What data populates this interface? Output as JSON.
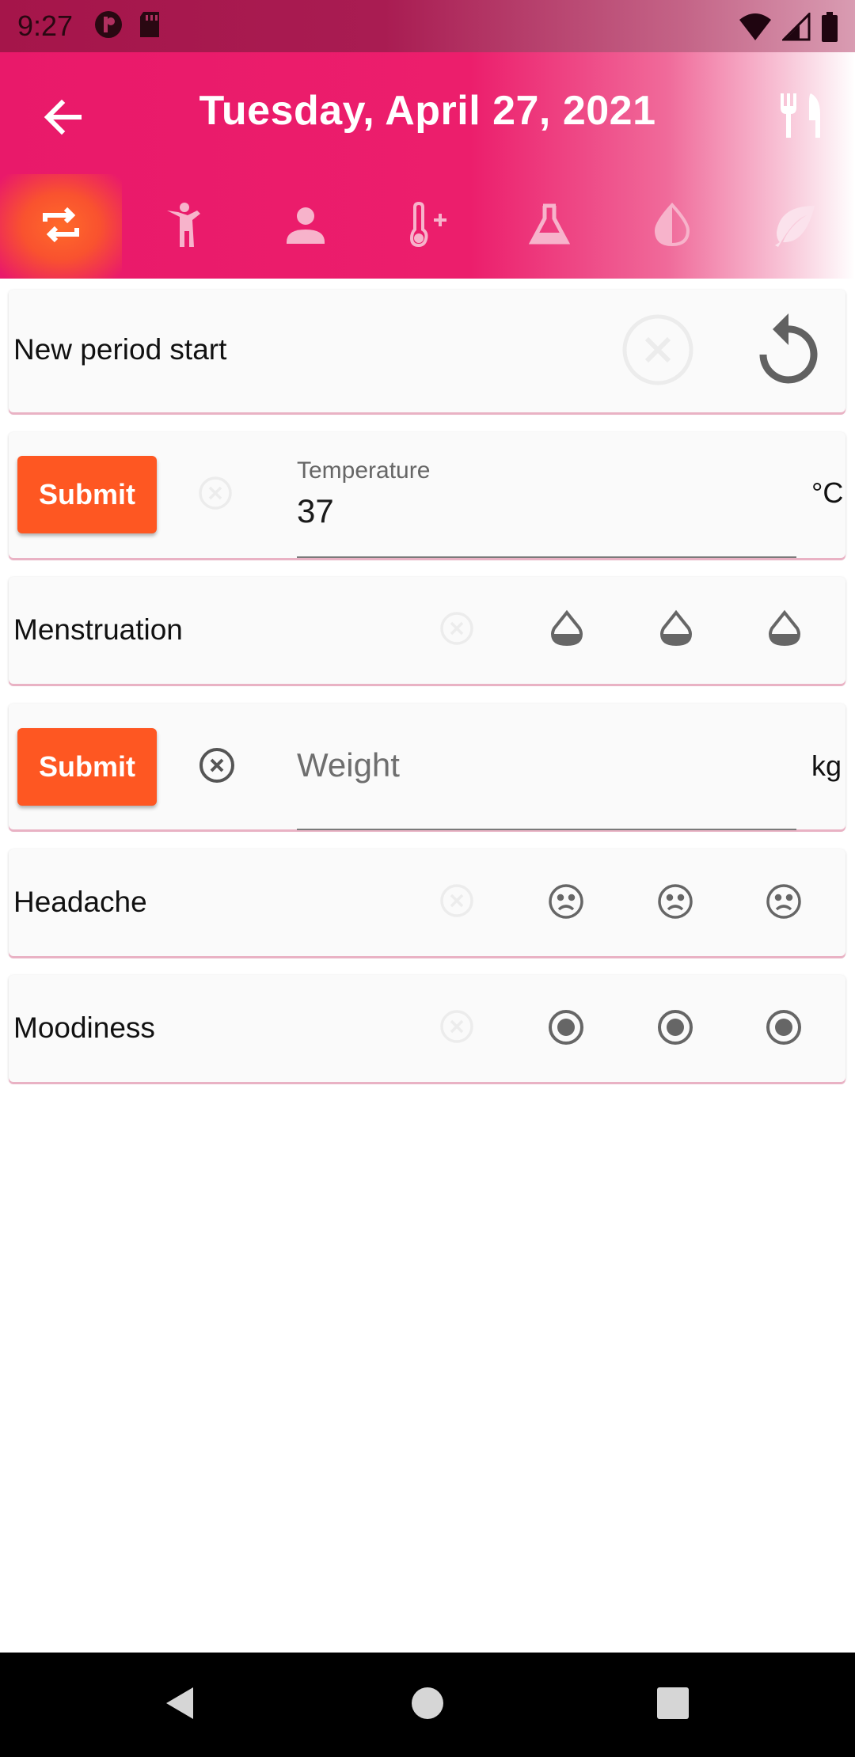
{
  "status_bar": {
    "time": "9:27",
    "icons": [
      "app-notification-icon",
      "sd-card-icon",
      "wifi-icon",
      "signal-icon",
      "battery-icon"
    ]
  },
  "header": {
    "title": "Tuesday, April 27, 2021",
    "back_icon": "arrow-back-icon",
    "action_icon": "restaurant-icon",
    "tabs": [
      {
        "icon": "repeat-icon",
        "active": true
      },
      {
        "icon": "exercise-icon",
        "active": false
      },
      {
        "icon": "person-icon",
        "active": false
      },
      {
        "icon": "thermometer-plus-icon",
        "active": false
      },
      {
        "icon": "flask-icon",
        "active": false
      },
      {
        "icon": "drop-icon",
        "active": false
      },
      {
        "icon": "leaf-icon",
        "active": false
      }
    ]
  },
  "cards": {
    "period": {
      "label": "New period start",
      "clear_icon": "cancel-icon",
      "action_icon": "replay-icon"
    },
    "temperature": {
      "submit_label": "Submit",
      "field_label": "Temperature",
      "value": "37",
      "unit": "°C"
    },
    "menstruation": {
      "label": "Menstruation",
      "levels": [
        "drop-icon",
        "drop-icon",
        "drop-icon"
      ]
    },
    "weight": {
      "submit_label": "Submit",
      "placeholder": "Weight",
      "value": "",
      "unit": "kg"
    },
    "headache": {
      "label": "Headache",
      "levels": [
        "sad-face-icon",
        "sad-face-icon",
        "sad-face-icon"
      ]
    },
    "moodiness": {
      "label": "Moodiness",
      "levels": [
        "radio-checked-icon",
        "radio-checked-icon",
        "radio-checked-icon"
      ]
    }
  },
  "colors": {
    "primary": "#ec1e6c",
    "accent": "#fe5722",
    "status_bar": "#a5154a",
    "card_bg": "#fafafa",
    "icon_gray": "#666666"
  },
  "nav_bar": {
    "buttons": [
      "back-triangle-icon",
      "home-circle-icon",
      "recents-square-icon"
    ]
  }
}
